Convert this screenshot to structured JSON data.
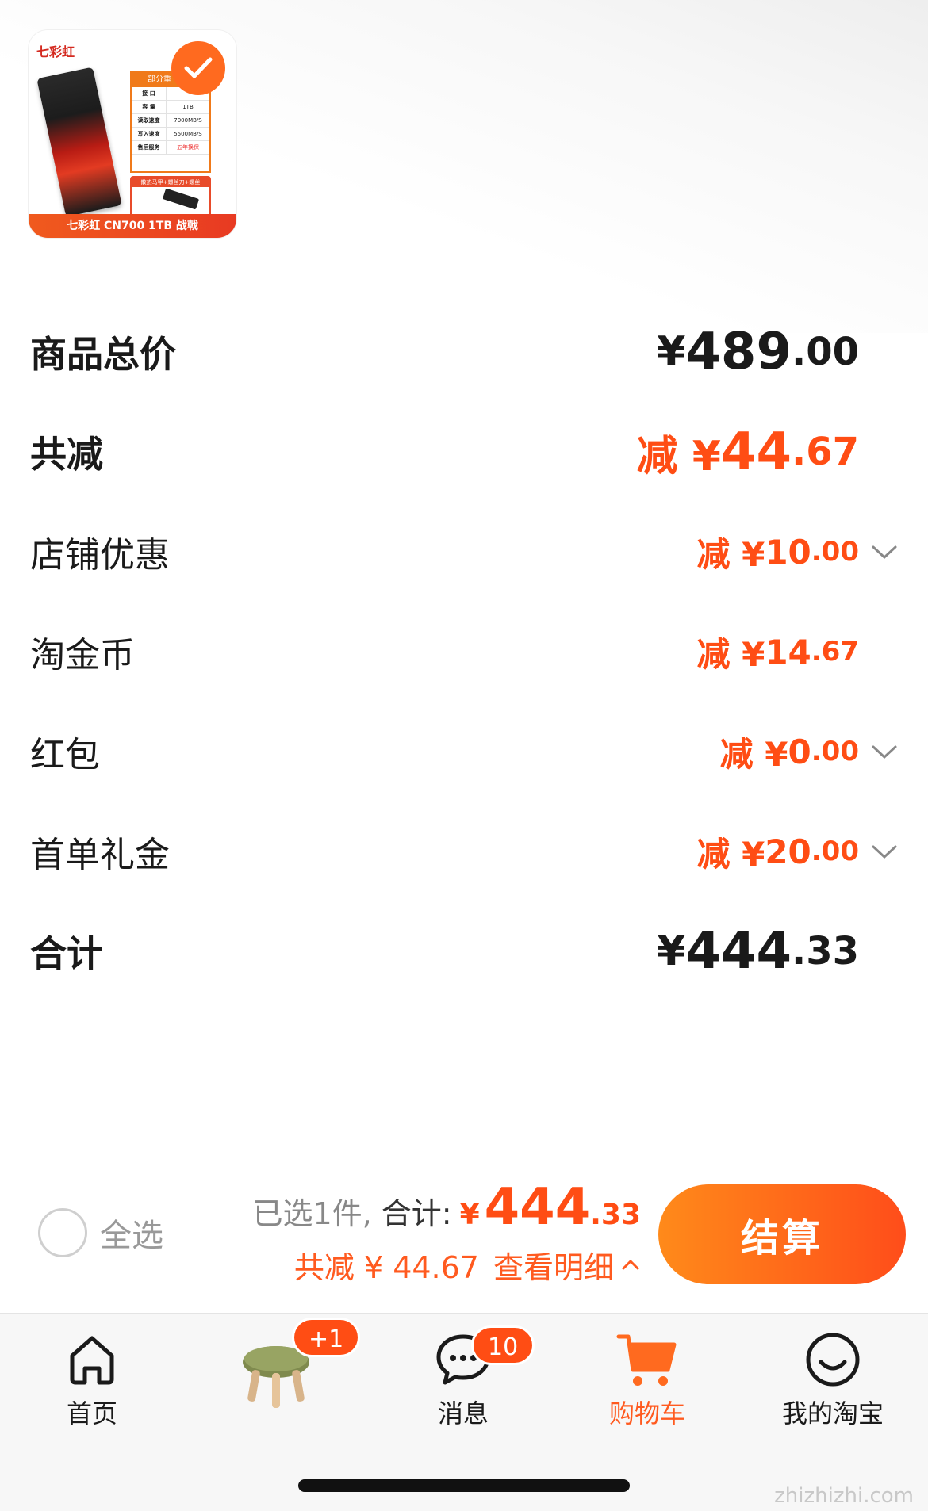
{
  "product": {
    "brand": "七彩虹",
    "footer_text": "七彩虹 CN700 1TB 战戟",
    "spec_header": "部分重",
    "spec_rows": [
      {
        "k": "接 口",
        "v": ""
      },
      {
        "k": "容 量",
        "v": "1TB"
      },
      {
        "k": "读取速度",
        "v": "7000MB/S"
      },
      {
        "k": "写入速度",
        "v": "5500MB/S"
      },
      {
        "k": "售后服务",
        "v": "五年换保"
      }
    ],
    "accessory_text": "散热马甲+螺丝刀+螺丝",
    "selected": true
  },
  "price_rows": {
    "total_goods": {
      "label": "商品总价",
      "currency": "¥",
      "int": "489",
      "dec": ".00"
    },
    "total_discount": {
      "label": "共减",
      "prefix": "减 ¥",
      "int": "44",
      "dec": ".67"
    },
    "shop_coupon": {
      "label": "店铺优惠",
      "prefix": "减 ¥",
      "int": "10",
      "dec": ".00",
      "has_dropdown": true
    },
    "taojin_coin": {
      "label": "淘金币",
      "prefix": "减 ¥",
      "int": "14",
      "dec": ".67",
      "has_dropdown": false
    },
    "red_packet": {
      "label": "红包",
      "prefix": "减 ¥",
      "int": "0",
      "dec": ".00",
      "has_dropdown": true
    },
    "first_order": {
      "label": "首单礼金",
      "prefix": "减 ¥",
      "int": "20",
      "dec": ".00",
      "has_dropdown": true
    },
    "grand_total": {
      "label": "合计",
      "currency": "¥",
      "int": "444",
      "dec": ".33"
    }
  },
  "bottom_bar": {
    "select_all_label": "全选",
    "selected_count_text": "已选1件,",
    "total_label": "合计:",
    "currency": "¥",
    "total_int": "444",
    "total_dec": ".33",
    "discount_text": "共减 ¥ 44.67",
    "detail_link": "查看明细",
    "checkout_label": "结算"
  },
  "tabbar": {
    "items": [
      {
        "label": "首页",
        "icon": "home-icon"
      },
      {
        "label": "",
        "icon": "stool-product-icon",
        "badge": "+1"
      },
      {
        "label": "消息",
        "icon": "message-icon",
        "badge": "10"
      },
      {
        "label": "购物车",
        "icon": "cart-icon",
        "active": true
      },
      {
        "label": "我的淘宝",
        "icon": "smile-face-icon"
      }
    ]
  },
  "watermark": "zhizhizhi.com",
  "colors": {
    "accent": "#ff4d14",
    "checkout_gradient_start": "#ff8a1a",
    "checkout_gradient_end": "#ff4d1a"
  }
}
